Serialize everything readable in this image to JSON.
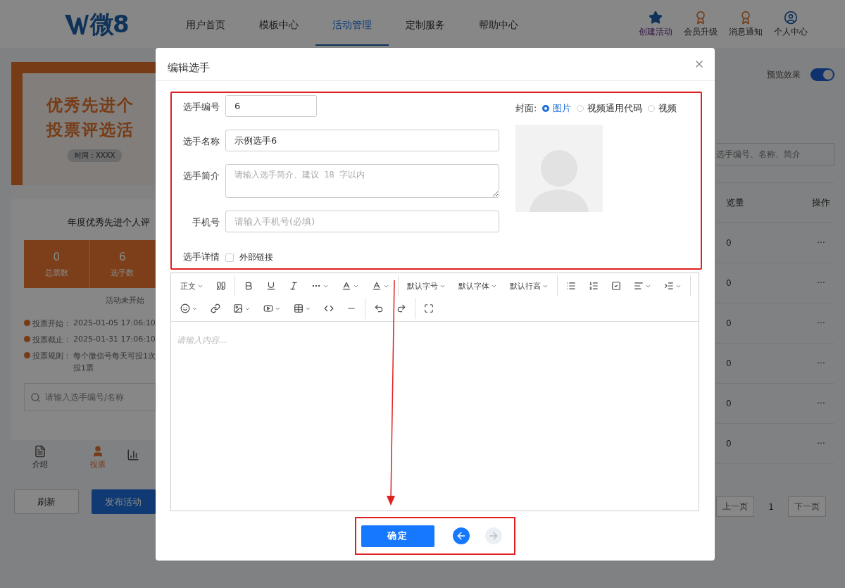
{
  "header": {
    "logo": "微8",
    "nav": [
      {
        "label": "用户首页",
        "selected": false
      },
      {
        "label": "模板中心",
        "selected": false
      },
      {
        "label": "活动管理",
        "selected": true
      },
      {
        "label": "定制服务",
        "selected": false
      },
      {
        "label": "帮助中心",
        "selected": false
      }
    ],
    "actions": [
      {
        "kind": "star",
        "label": "创建活动"
      },
      {
        "kind": "badge",
        "label": "会员升级"
      },
      {
        "kind": "badge",
        "label": "消息通知"
      },
      {
        "kind": "user",
        "label": "个人中心"
      }
    ]
  },
  "preview": {
    "banner_lines": [
      "优秀先进个",
      "投票评选活"
    ],
    "banner_tag": "时间：XXXX",
    "title": "年度优秀先进个人评",
    "stats": [
      {
        "value": "0",
        "label": "总票数"
      },
      {
        "value": "6",
        "label": "选手数"
      }
    ],
    "status": "活动未开始",
    "info": [
      {
        "label": "投票开始：",
        "value": "2025-01-05 17:06:10"
      },
      {
        "label": "投票截止：",
        "value": "2025-01-31 17:06:10"
      },
      {
        "label": "投票规则：",
        "value": "每个微信号每天可投1次"
      }
    ],
    "info_more": "投1票",
    "search": {
      "placeholder": "请输入选手编号/名称"
    },
    "tabs": [
      {
        "kind": "doc",
        "label": "介绍",
        "selected": false
      },
      {
        "kind": "user",
        "label": "投票",
        "selected": true
      }
    ],
    "buttons": [
      {
        "label": "刷新",
        "kind": "plain"
      },
      {
        "label": "发布活动",
        "kind": "primary"
      }
    ]
  },
  "right": {
    "preview_label": "预览效果",
    "preview_on": true,
    "search": {
      "placeholder": "选手编号、名称、简介"
    },
    "columns": [
      "览量",
      "操作"
    ],
    "rows": [
      {
        "views": "0",
        "action": "···"
      },
      {
        "views": "0",
        "action": "···"
      },
      {
        "views": "0",
        "action": "···"
      },
      {
        "views": "0",
        "action": "···"
      },
      {
        "views": "0",
        "action": "···"
      },
      {
        "views": "0",
        "action": "···"
      }
    ],
    "pagination": {
      "prev": "上一页",
      "page": "1",
      "next": "下一页"
    }
  },
  "modal": {
    "title": "编辑选手",
    "fields": [
      {
        "label": "选手编号",
        "value": "6",
        "kind": "short"
      },
      {
        "label": "选手名称",
        "value": "示例选手6",
        "kind": "input"
      },
      {
        "label": "选手简介",
        "placeholder": "请输入选手简介、建议 18 字以内",
        "kind": "textarea"
      },
      {
        "label": "手机号",
        "placeholder": "请输入手机号(必填)",
        "kind": "input"
      }
    ],
    "detail": {
      "label": "选手详情",
      "checkbox": "外部链接",
      "checked": false
    },
    "cover": {
      "label": "封面:",
      "options": [
        {
          "label": "图片",
          "selected": true
        },
        {
          "label": "视频通用代码",
          "selected": false
        },
        {
          "label": "视频",
          "selected": false
        }
      ]
    },
    "toolbar_labels": [
      "正文",
      "默认字号",
      "默认字体",
      "默认行高"
    ],
    "editor": {
      "placeholder": "请输入内容..."
    },
    "confirm": "确定",
    "back_disabled": false,
    "forward_disabled": true
  }
}
